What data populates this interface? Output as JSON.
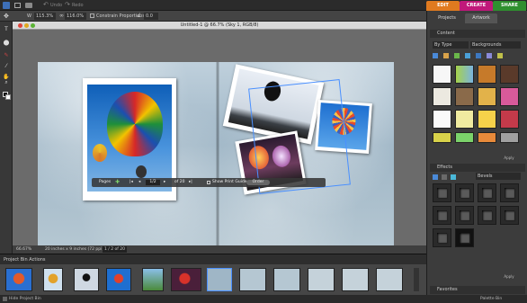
{
  "menu": {
    "undo_label": "Undo",
    "redo_label": "Redo",
    "modes": [
      {
        "label": "EDIT",
        "color": "#e07a1f"
      },
      {
        "label": "CREATE",
        "color": "#c0187a"
      },
      {
        "label": "SHARE",
        "color": "#2f8f2f"
      }
    ]
  },
  "options": {
    "width_value": "115.3%",
    "height_value": "116.0%",
    "constrain_label": "Constrain Proportions",
    "angle_value": "0.0"
  },
  "tools": {
    "icons": [
      "text-icon",
      "move-icon",
      "brush-icon",
      "eyedropper-icon",
      "hand-icon",
      "zoom-icon",
      "color-swatch-icon"
    ]
  },
  "document": {
    "title": "Untitled-1 @ 66.7% (Sky 1, RGB/8)",
    "zoom": "66.67%",
    "size": "20 inches x 9 inches (72 ppi)",
    "page_indicator": "1 / 2 of 20"
  },
  "pages_bar": {
    "label": "Pages",
    "page_value": "1/2",
    "of_label": "of 20",
    "print_guides_label": "Show Print Guides",
    "order_button": "Order"
  },
  "right_panel": {
    "tabs": [
      {
        "label": "Projects"
      },
      {
        "label": "Artwork"
      }
    ],
    "content_title": "Content",
    "by_type_label": "By Type",
    "backgrounds_label": "Backgrounds",
    "apply_label": "Apply",
    "effects_title": "Effects",
    "bevels_label": "Bevels",
    "apply2_label": "Apply",
    "favorites_title": "Favorites",
    "palette_bin_label": "Palette Bin"
  },
  "bin": {
    "header_label": "Project Bin Actions",
    "hide_label": "Hide Project Bin"
  }
}
